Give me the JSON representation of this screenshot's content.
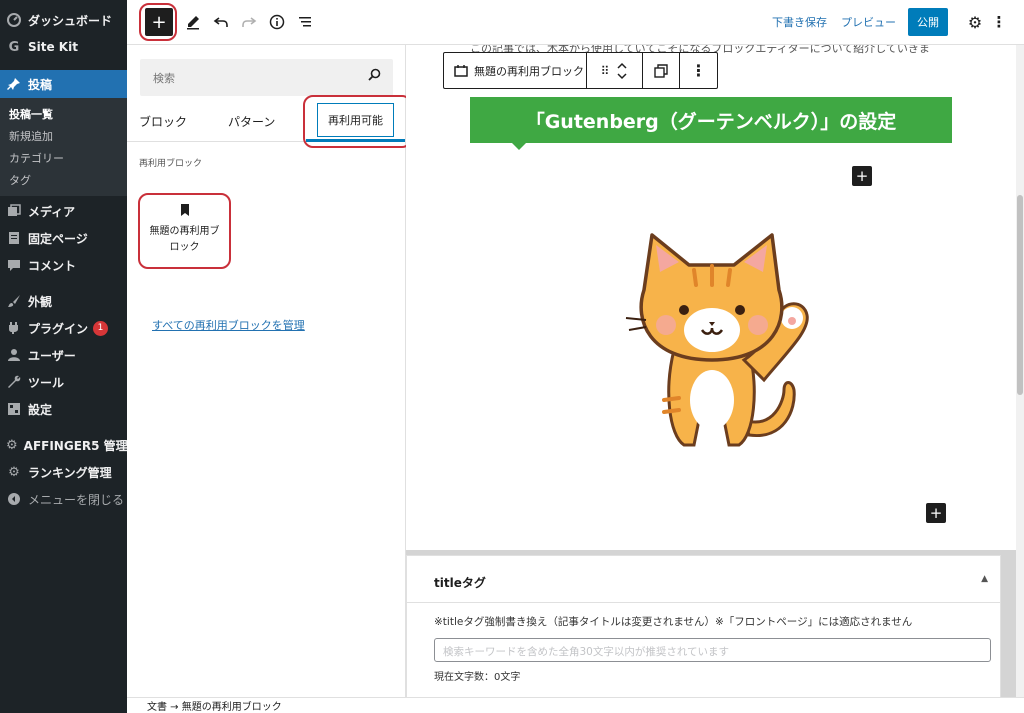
{
  "sidebar": {
    "items": [
      {
        "id": "dashboard",
        "label": "ダッシュボード",
        "icon": "dashboard-icon"
      },
      {
        "id": "sitekit",
        "label": "Site Kit",
        "icon": "google-g-icon"
      },
      {
        "id": "posts",
        "label": "投稿",
        "icon": "pin-icon",
        "active": true
      },
      {
        "id": "media",
        "label": "メディア",
        "icon": "media-icon"
      },
      {
        "id": "pages",
        "label": "固定ページ",
        "icon": "page-icon"
      },
      {
        "id": "comments",
        "label": "コメント",
        "icon": "comment-icon"
      },
      {
        "id": "appearance",
        "label": "外観",
        "icon": "brush-icon"
      },
      {
        "id": "plugins",
        "label": "プラグイン",
        "icon": "plugin-icon",
        "badge": "1"
      },
      {
        "id": "users",
        "label": "ユーザー",
        "icon": "user-icon"
      },
      {
        "id": "tools",
        "label": "ツール",
        "icon": "wrench-icon"
      },
      {
        "id": "settings",
        "label": "設定",
        "icon": "settings-icon"
      },
      {
        "id": "affinger",
        "label": "AFFINGER5 管理",
        "icon": "gear-icon"
      },
      {
        "id": "ranking",
        "label": "ランキング管理",
        "icon": "gear-icon"
      },
      {
        "id": "collapse",
        "label": "メニューを閉じる",
        "icon": "collapse-icon"
      }
    ],
    "submenu": [
      "投稿一覧",
      "新規追加",
      "カテゴリー",
      "タグ"
    ]
  },
  "toolbar": {
    "add_icon": "+",
    "save_draft": "下書き保存",
    "preview": "プレビュー",
    "publish": "公開"
  },
  "inserter": {
    "search_placeholder": "検索",
    "tabs": [
      "ブロック",
      "パターン",
      "再利用可能"
    ],
    "section_title": "再利用ブロック",
    "block_label": "無題の再利用ブロック",
    "manage_link": "すべての再利用ブロックを管理"
  },
  "canvas": {
    "prev_text": "この記事では、木本から使用していてこそになるブロックエディターについて紹介していきま",
    "block_toolbar_title": "無題の再利用ブロック",
    "heading": "「Gutenberg（グーテンベルク）」の設定"
  },
  "meta": {
    "title": "titleタグ",
    "note": "※titleタグ強制書き換え（記事タイトルは変更されません）※「フロントページ」には適応されません",
    "input_placeholder": "検索キーワードを含めた全角30文字以内が推奨されています",
    "count": "現在文字数：0文字"
  },
  "footer": {
    "breadcrumb": "文書 → 無題の再利用ブロック"
  },
  "colors": {
    "wp_sidebar": "#1d2327",
    "wp_active": "#2271b1",
    "publish": "#007cba",
    "heading_green": "#3fa843",
    "highlight_red": "#c9303a"
  }
}
